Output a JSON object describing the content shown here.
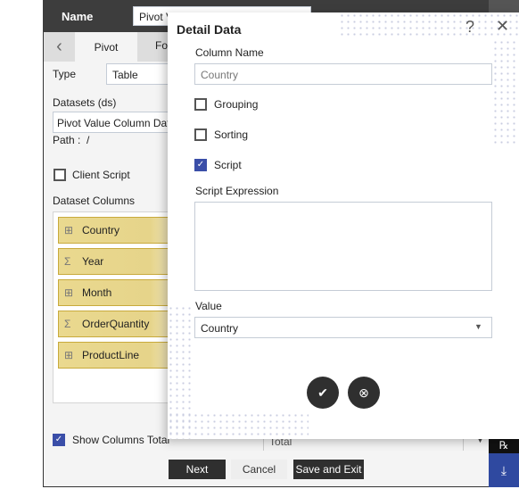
{
  "header": {
    "name_label": "Name",
    "name_value": "Pivot V"
  },
  "tabs": [
    {
      "label": "Pivot"
    },
    {
      "label": "Fo"
    }
  ],
  "left": {
    "type_label": "Type",
    "type_value": "Table",
    "datasets_label": "Datasets (ds)",
    "datasets_value": "Pivot Value Column Dat",
    "path_label": "Path :",
    "path_value": "/",
    "client_script_label": "Client Script",
    "client_script_checked": false,
    "dataset_columns_label": "Dataset Columns",
    "columns": [
      {
        "label": "Country",
        "icon": "table-icon"
      },
      {
        "label": "Year",
        "icon": "sigma-icon"
      },
      {
        "label": "Month",
        "icon": "table-icon"
      },
      {
        "label": "OrderQuantity",
        "icon": "sigma-icon"
      },
      {
        "label": "ProductLine",
        "icon": "table-icon"
      }
    ],
    "show_columns_total_label": "Show Columns Total",
    "show_columns_total_checked": true,
    "total_value": "Total"
  },
  "footer": {
    "next": "Next",
    "cancel": "Cancel",
    "save_exit": "Save and Exit"
  },
  "dialog": {
    "title": "Detail Data",
    "column_name_label": "Column Name",
    "column_name_placeholder": "Country",
    "grouping_label": "Grouping",
    "grouping_checked": false,
    "sorting_label": "Sorting",
    "sorting_checked": false,
    "script_label": "Script",
    "script_checked": true,
    "script_expression_label": "Script Expression",
    "script_expression_value": "",
    "value_label": "Value",
    "value_selected": "Country"
  },
  "colors": {
    "header": "#3d3d3d",
    "accent": "#3a4ea8",
    "column_item": "#ead98f",
    "dark_button": "#2f2f2f"
  }
}
